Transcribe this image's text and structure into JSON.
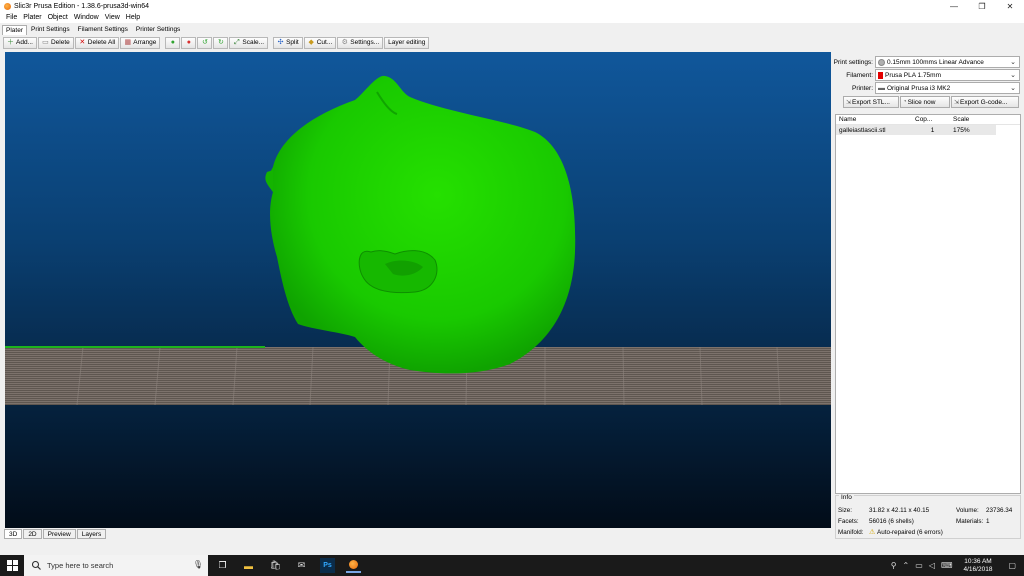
{
  "window": {
    "title": "Slic3r Prusa Edition - 1.38.6-prusa3d-win64",
    "min": "—",
    "max": "❐",
    "close": "✕"
  },
  "menu": [
    "File",
    "Plater",
    "Object",
    "Window",
    "View",
    "Help"
  ],
  "tabs": [
    "Plater",
    "Print Settings",
    "Filament Settings",
    "Printer Settings"
  ],
  "toolbar": {
    "add": "Add...",
    "delete": "Delete",
    "delete_all": "Delete All",
    "arrange": "Arrange",
    "scale": "Scale...",
    "split": "Split",
    "cut": "Cut...",
    "settings": "Settings...",
    "layer_editing": "Layer editing"
  },
  "view_tabs": [
    "3D",
    "2D",
    "Preview",
    "Layers"
  ],
  "settings": {
    "print_label": "Print settings:",
    "print_value": "0.15mm 100mms Linear Advance",
    "filament_label": "Filament:",
    "filament_value": "Prusa PLA 1.75mm",
    "printer_label": "Printer:",
    "printer_value": "Original Prusa i3 MK2"
  },
  "buttons": {
    "export_stl": "Export STL...",
    "slice_now": "Slice now",
    "export_gcode": "Export G-code..."
  },
  "objects": {
    "headers": [
      "Name",
      "Cop...",
      "Scale"
    ],
    "rows": [
      {
        "name": "galleiastlascii.stl",
        "copies": "1",
        "scale": "175%"
      }
    ]
  },
  "info": {
    "title": "Info",
    "size_label": "Size:",
    "size": "31.82 x 42.11 x 40.15",
    "volume_label": "Volume:",
    "volume": "23736.34",
    "facets_label": "Facets:",
    "facets": "56016 (6 shells)",
    "materials_label": "Materials:",
    "materials": "1",
    "manifold_label": "Manifold:",
    "manifold": "Auto-repaired (6 errors)"
  },
  "taskbar": {
    "search_placeholder": "Type here to search",
    "time": "10:36 AM",
    "date": "4/16/2018"
  },
  "colors": {
    "model": "#1bd100",
    "viewport_top": "#10579b",
    "bed": "#6e655f"
  }
}
